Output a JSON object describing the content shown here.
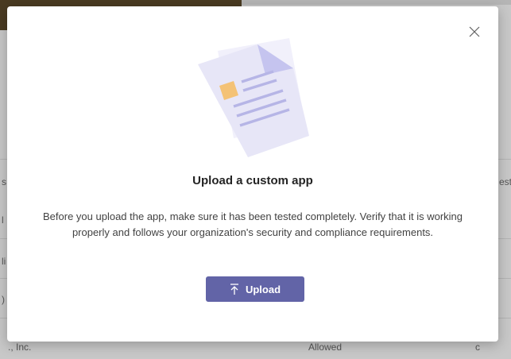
{
  "background": {
    "fragments": [
      "s",
      "est",
      "l",
      "li",
      ")",
      "., Inc.",
      "Allowed",
      "c"
    ]
  },
  "dialog": {
    "close_icon": "close-icon",
    "illustration_icon": "document-illustration",
    "title": "Upload a custom app",
    "description": "Before you upload the app, make sure it has been tested completely. Verify that it is working properly and follows your organization's security and compliance requirements.",
    "upload_button": {
      "label": "Upload",
      "icon": "upload-arrow-icon"
    }
  },
  "colors": {
    "accent": "#6264a7",
    "paper": "#e7e6f7",
    "paper_fold": "#c5c4ef",
    "paper_lines": "#b6b5e6",
    "stamp": "#f4c276"
  }
}
